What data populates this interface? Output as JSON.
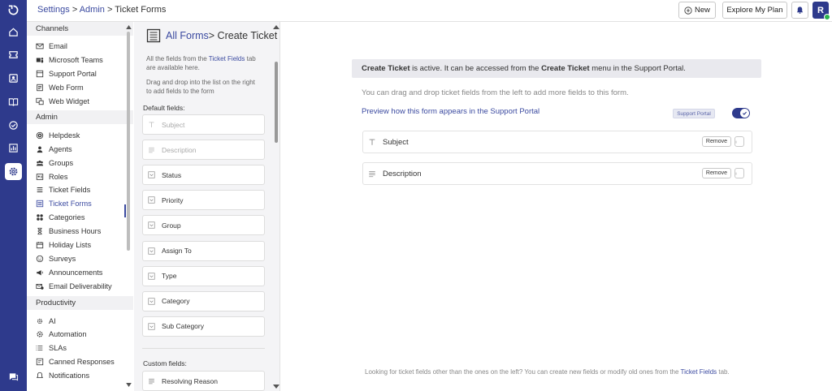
{
  "breadcrumb": {
    "settings": "Settings",
    "sep": ">",
    "admin": "Admin",
    "current": "Ticket Forms"
  },
  "topbar": {
    "new_label": "New",
    "explore_label": "Explore My Plan",
    "avatar_letter": "R"
  },
  "nav": {
    "channels_heading": "Channels",
    "channels": [
      {
        "label": "Email",
        "icon": "mail-icon"
      },
      {
        "label": "Microsoft Teams",
        "icon": "teams-icon"
      },
      {
        "label": "Support Portal",
        "icon": "portal-icon"
      },
      {
        "label": "Web Form",
        "icon": "webform-icon"
      },
      {
        "label": "Web Widget",
        "icon": "widget-icon"
      }
    ],
    "admin_heading": "Admin",
    "admin": [
      {
        "label": "Helpdesk",
        "icon": "helpdesk-icon"
      },
      {
        "label": "Agents",
        "icon": "agents-icon"
      },
      {
        "label": "Groups",
        "icon": "groups-icon"
      },
      {
        "label": "Roles",
        "icon": "roles-icon"
      },
      {
        "label": "Ticket Fields",
        "icon": "fields-icon"
      },
      {
        "label": "Ticket Forms",
        "icon": "forms-icon"
      },
      {
        "label": "Categories",
        "icon": "categories-icon"
      },
      {
        "label": "Business Hours",
        "icon": "hourglass-icon"
      },
      {
        "label": "Holiday Lists",
        "icon": "calendar-icon"
      },
      {
        "label": "Surveys",
        "icon": "smiley-icon"
      },
      {
        "label": "Announcements",
        "icon": "megaphone-icon"
      },
      {
        "label": "Email Deliverability",
        "icon": "deliverability-icon"
      }
    ],
    "productivity_heading": "Productivity",
    "productivity": [
      {
        "label": "AI",
        "icon": "ai-icon"
      },
      {
        "label": "Automation",
        "icon": "automation-icon"
      },
      {
        "label": "SLAs",
        "icon": "sla-icon"
      },
      {
        "label": "Canned Responses",
        "icon": "canned-icon"
      },
      {
        "label": "Notifications",
        "icon": "bell-icon"
      }
    ]
  },
  "palette": {
    "title_link": "All Forms",
    "title_rest": "> Create Ticket",
    "desc1_a": "All the fields from the",
    "desc1_link": "Ticket Fields",
    "desc1_b": "tab are available here.",
    "desc2": "Drag and drop into the list on the right to add fields to the form",
    "default_label": "Default fields:",
    "default_fields": [
      {
        "label": "Subject",
        "dim": true,
        "icon": "text-icon"
      },
      {
        "label": "Description",
        "dim": true,
        "icon": "paragraph-icon"
      },
      {
        "label": "Status",
        "dim": false,
        "icon": "dropdown-icon"
      },
      {
        "label": "Priority",
        "dim": false,
        "icon": "dropdown-icon"
      },
      {
        "label": "Group",
        "dim": false,
        "icon": "dropdown-icon"
      },
      {
        "label": "Assign To",
        "dim": false,
        "icon": "dropdown-icon"
      },
      {
        "label": "Type",
        "dim": false,
        "icon": "dropdown-icon"
      },
      {
        "label": "Category",
        "dim": false,
        "icon": "dropdown-icon"
      },
      {
        "label": "Sub Category",
        "dim": false,
        "icon": "dropdown-icon"
      }
    ],
    "custom_label": "Custom fields:",
    "custom_fields": [
      {
        "label": "Resolving Reason",
        "icon": "paragraph-icon"
      }
    ]
  },
  "main": {
    "banner_a": "Create Ticket",
    "banner_b": " is active. It can be accessed from the ",
    "banner_c": "Create Ticket",
    "banner_d": " menu in the Support Portal.",
    "info": "You can drag and drop ticket fields from the left to add more fields to this form.",
    "preview_link": "Preview how this form appears in the Support Portal",
    "badge": "Support Portal",
    "toggle_on": true,
    "form_fields": [
      {
        "label": "Subject",
        "remove": "Remove",
        "icon": "text-icon"
      },
      {
        "label": "Description",
        "remove": "Remove",
        "icon": "paragraph-icon"
      }
    ],
    "footer_a": "Looking for ticket fields other than the ones on the left? You can create new fields or modify old ones from the ",
    "footer_link": "Ticket Fields",
    "footer_b": " tab."
  },
  "colors": {
    "rail": "#2e3a8c",
    "accent": "#3b4aa0",
    "success": "#2bb24c"
  }
}
